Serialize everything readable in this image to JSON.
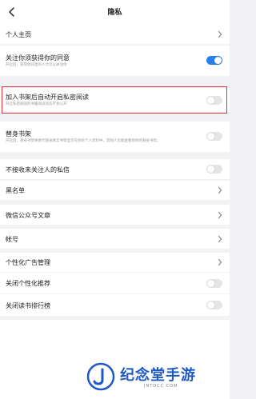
{
  "header": {
    "title": "隐私"
  },
  "sections": {
    "personal_home": {
      "label": "个人主页"
    },
    "follow_consent": {
      "label": "关注你须获得你的同意",
      "sub": "开启后，获得你同意的人才可以关注你",
      "toggle": "on"
    },
    "auto_private_reading": {
      "label": "加入书架后自动开启私密阅读",
      "sub": "开启私密阅读的书籍阅读动态不会公开",
      "toggle": "off"
    },
    "proxy_shelf": {
      "label": "替身书架",
      "sub": "开启后，替身书架将替代替身真实书架显示在你的个人资料中，其他人仅能查看到你的替身书架。",
      "toggle": "off"
    },
    "no_stranger_msgs": {
      "label": "不接收未关注人的私信",
      "toggle": "off"
    },
    "blacklist": {
      "label": "黑名单"
    },
    "wechat_articles": {
      "label": "微信公众号文章"
    },
    "account": {
      "label": "帐号"
    },
    "ad_management": {
      "label": "个性化广告管理"
    },
    "close_personal_recommend": {
      "label": "关闭个性化推荐",
      "toggle": "off"
    },
    "close_ranking": {
      "label": "关闭读书排行榜",
      "toggle": "off"
    }
  },
  "watermark": {
    "brand": "纪念堂手游",
    "url": "JNTDCC.COM"
  },
  "colors": {
    "accent": "#2680eb",
    "highlight": "#e0353a",
    "brand": "#1f58c4"
  }
}
